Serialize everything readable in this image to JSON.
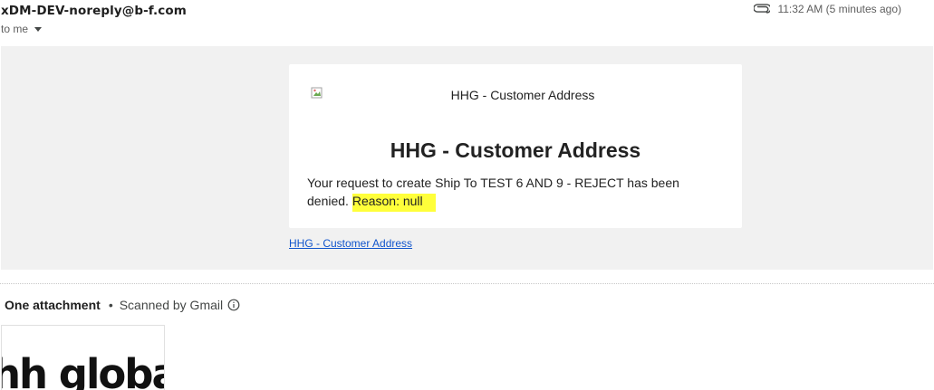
{
  "header": {
    "sender": "xDM-DEV-noreply@b-f.com",
    "recipient": "to me",
    "timestamp": "11:32 AM (5 minutes ago)",
    "icons": {
      "attachment": "paperclip-icon",
      "recipient_menu": "chevron-down-icon"
    }
  },
  "message": {
    "image_alt": "HHG - Customer Address",
    "title": "HHG - Customer Address",
    "body_text": "Your request to create Ship To TEST 6 AND 9 - REJECT has been denied.",
    "highlighted_text": "Reason: null",
    "footer_link": "HHG - Customer Address",
    "colors": {
      "highlight": "#ffff3a",
      "link": "#1155cc",
      "band": "#f1f1f1"
    }
  },
  "attachments": {
    "count_label": "One attachment",
    "scan_label": "Scanned by Gmail",
    "thumbnail_text": "hh global",
    "icons": {
      "info": "info-icon"
    }
  }
}
